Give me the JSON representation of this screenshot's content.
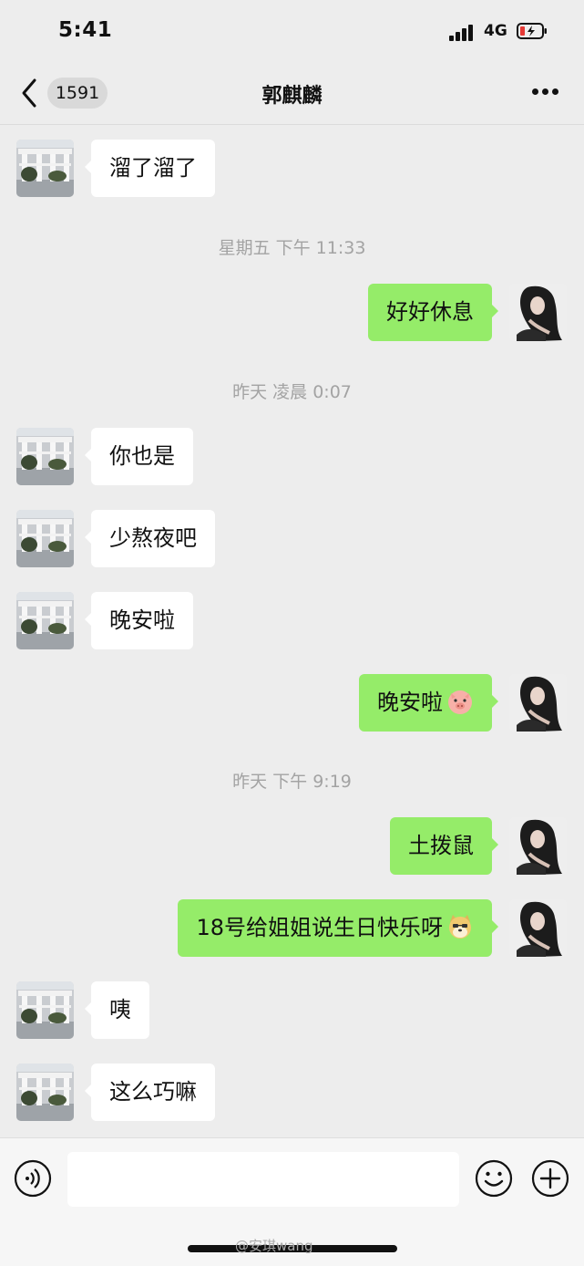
{
  "status": {
    "time": "5:41",
    "network": "4G"
  },
  "nav": {
    "unread_count": "1591",
    "title": "郭麒麟"
  },
  "messages": [
    {
      "text": "溜了溜了"
    },
    {
      "text": "好好休息"
    },
    {
      "text": "你也是"
    },
    {
      "text": "少熬夜吧"
    },
    {
      "text": "晚安啦"
    },
    {
      "text": "晚安啦"
    },
    {
      "text": "土拨鼠"
    },
    {
      "text": "18号给姐姐说生日快乐呀"
    },
    {
      "text": "咦"
    },
    {
      "text": "这么巧嘛"
    }
  ],
  "timestamps": [
    "星期五 下午 11:33",
    "昨天 凌晨 0:07",
    "昨天 下午 9:19"
  ],
  "watermark": "@安琪wang",
  "colors": {
    "background": "#ededed",
    "incoming_bubble": "#ffffff",
    "outgoing_bubble": "#95ec69"
  },
  "icons": [
    "back-chevron-icon",
    "more-icon",
    "voice-icon",
    "emoji-icon",
    "plus-icon",
    "pig-emoji-icon",
    "doge-emoji-icon"
  ]
}
